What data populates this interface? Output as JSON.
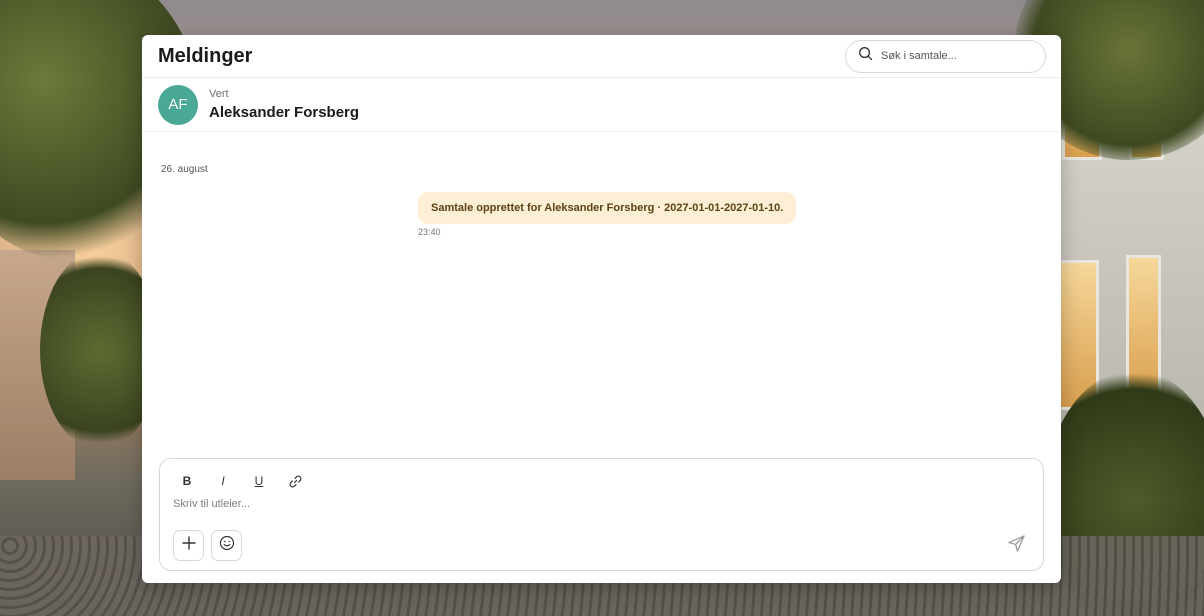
{
  "header": {
    "title": "Meldinger",
    "search_placeholder": "Søk i samtale..."
  },
  "conversation": {
    "avatar_initials": "AF",
    "role": "Vert",
    "name": "Aleksander Forsberg"
  },
  "messages": {
    "date": "26. august",
    "items": [
      {
        "text": "Samtale opprettet for Aleksander Forsberg · 2027-01-01-2027-01-10.",
        "time": "23:40"
      }
    ]
  },
  "composer": {
    "bold_label": "B",
    "italic_label": "I",
    "underline_label": "U",
    "placeholder": "Skriv til utleier..."
  },
  "colors": {
    "avatar_bg": "#4aa897",
    "system_bubble_bg": "#fcefd6",
    "system_bubble_text": "#5b4212"
  }
}
